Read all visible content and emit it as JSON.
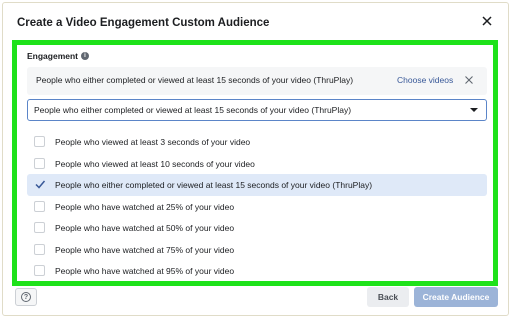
{
  "dialog": {
    "title": "Create a Video Engagement Custom Audience"
  },
  "engagement": {
    "label": "Engagement",
    "info_icon_glyph": "i",
    "selected_card": {
      "text": "People who either completed or viewed at least 15 seconds of your video (ThruPlay)",
      "choose_videos_label": "Choose videos"
    },
    "dropdown_value": "People who either completed or viewed at least 15 seconds of your video (ThruPlay)",
    "options": [
      {
        "label": "People who viewed at least 3 seconds of your video",
        "selected": false
      },
      {
        "label": "People who viewed at least 10 seconds of your video",
        "selected": false
      },
      {
        "label": "People who either completed or viewed at least 15 seconds of your video (ThruPlay)",
        "selected": true
      },
      {
        "label": "People who have watched at 25% of your video",
        "selected": false
      },
      {
        "label": "People who have watched at 50% of your video",
        "selected": false
      },
      {
        "label": "People who have watched at 75% of your video",
        "selected": false
      },
      {
        "label": "People who have watched at 95% of your video",
        "selected": false
      }
    ]
  },
  "footer": {
    "help_glyph": "?",
    "back_label": "Back",
    "create_label": "Create Audience"
  },
  "colors": {
    "highlight_border": "#1ee21a",
    "link": "#385898",
    "selected_row": "#dfe9f8",
    "primary_disabled": "#9cb4d8",
    "check": "#385898"
  },
  "icons": {
    "close": "close-icon",
    "info": "info-icon",
    "caret": "chevron-down-icon",
    "check": "checkmark-icon",
    "help": "help-icon"
  }
}
